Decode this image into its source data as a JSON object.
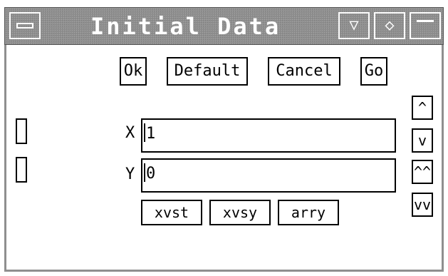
{
  "window": {
    "title": "Initial Data",
    "menu_glyph": "",
    "minimize_glyph": "▽",
    "maximize_glyph": "◇"
  },
  "buttons": {
    "ok": "Ok",
    "default": "Default",
    "cancel": "Cancel",
    "go": "Go"
  },
  "fields": {
    "x_label": "X",
    "x_value": "1",
    "y_label": "Y",
    "y_value": "0"
  },
  "plot_buttons": [
    "xvst",
    "xvsy",
    "arry"
  ],
  "scroll_buttons": {
    "up": "^",
    "down": "v",
    "page_up": "^^",
    "page_down": "vv"
  }
}
